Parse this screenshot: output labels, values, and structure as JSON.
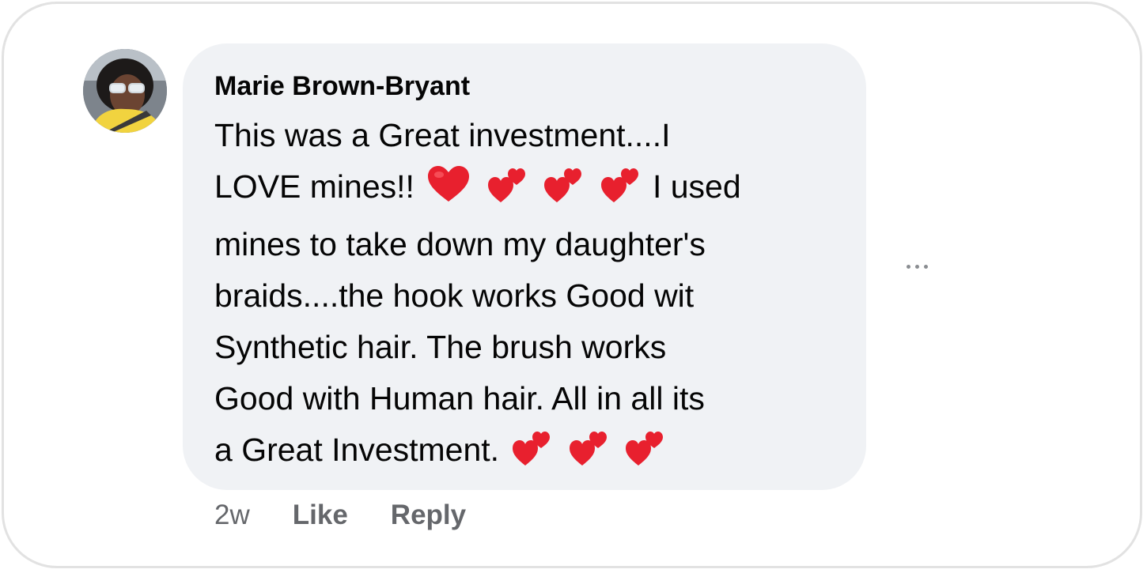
{
  "comment": {
    "author": "Marie Brown-Bryant",
    "text_lines": [
      {
        "before": "This was a Great investment....I",
        "emoji": "",
        "after": ""
      },
      {
        "before": "LOVE mines!!",
        "emoji": "red-heart two-hearts two-hearts two-hearts",
        "after": "I used"
      },
      {
        "before": "mines to take down my daughter's",
        "emoji": "",
        "after": ""
      },
      {
        "before": "braids....the hook works Good wit",
        "emoji": "",
        "after": ""
      },
      {
        "before": "Synthetic hair. The brush works",
        "emoji": "",
        "after": ""
      },
      {
        "before": "Good with Human hair. All in all its",
        "emoji": "",
        "after": ""
      },
      {
        "before": "a Great Investment.",
        "emoji": "two-hearts two-hearts two-hearts",
        "after": ""
      }
    ],
    "timestamp": "2w",
    "like_label": "Like",
    "reply_label": "Reply"
  },
  "icons": {
    "avatar": "user-avatar-photo",
    "more": "more-options-icon",
    "heart": "red-heart-emoji",
    "two_hearts": "two-hearts-emoji"
  },
  "colors": {
    "bubble": "#f0f2f5",
    "text": "#050505",
    "secondary": "#65676b",
    "heart": "#e8202e"
  }
}
